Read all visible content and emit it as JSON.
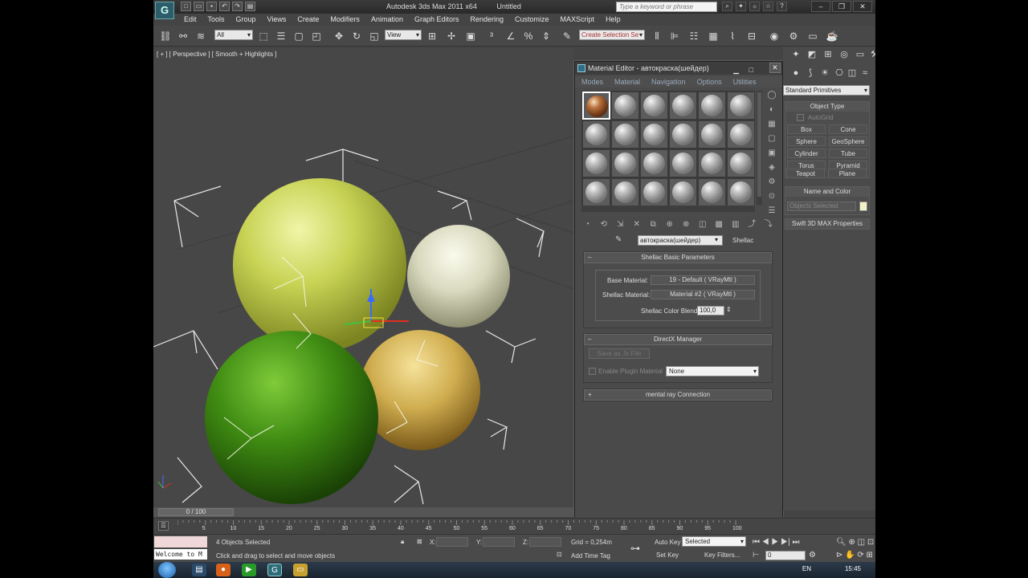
{
  "titlebar": {
    "app_name": "Autodesk 3ds Max 2011 x64",
    "document": "Untitled",
    "search_placeholder": "Type a keyword or phrase",
    "logo": "G"
  },
  "menu": [
    "Edit",
    "Tools",
    "Group",
    "Views",
    "Create",
    "Modifiers",
    "Animation",
    "Graph Editors",
    "Rendering",
    "Customize",
    "MAXScript",
    "Help"
  ],
  "toolbar": {
    "selection_filter": "All",
    "ref_coord": "View",
    "named_selection": "Create Selection Se"
  },
  "viewport": {
    "label": "[ + ] [ Perspective ] [ Smooth + Highlights ]"
  },
  "material_editor": {
    "title": "Material Editor - автокраска(шейдер)",
    "menu": [
      "Modes",
      "Material",
      "Navigation",
      "Options",
      "Utilities"
    ],
    "material_name": "автокраска(шейдер)",
    "material_type": "Shellac",
    "shellac_rollout": {
      "title": "Shellac Basic Parameters",
      "base_label": "Base Material:",
      "base_value": "19 - Default  ( VRayMtl )",
      "shellac_label": "Shellac Material:",
      "shellac_value": "Material #2  ( VRayMtl )",
      "blend_label": "Shellac Color Blend:",
      "blend_value": "100,0"
    },
    "directx_rollout": {
      "title": "DirectX Manager",
      "save_button": "Save as .fx File",
      "plugin_label": "Enable Plugin Material",
      "plugin_value": "None"
    },
    "mentalray_rollout": {
      "title": "mental ray Connection",
      "toggle": "+"
    }
  },
  "command_panel": {
    "category": "Standard Primitives",
    "object_type_title": "Object Type",
    "autogrid": "AutoGrid",
    "buttons": [
      "Box",
      "Cone",
      "Sphere",
      "GeoSphere",
      "Cylinder",
      "Tube",
      "Torus",
      "Pyramid",
      "Teapot",
      "Plane"
    ],
    "name_color_title": "Name and Color",
    "name_field": "Objects Selected",
    "swift": "Swift 3D MAX Properties"
  },
  "timeline": {
    "frame": "0 / 100",
    "ticks": [
      "5",
      "10",
      "15",
      "20",
      "25",
      "30",
      "35",
      "40",
      "45",
      "50",
      "55",
      "60",
      "65",
      "70",
      "75",
      "80",
      "85",
      "90",
      "95",
      "100"
    ]
  },
  "status": {
    "selection": "4 Objects Selected",
    "prompt": "Click and drag to select and move objects",
    "listener": "Welcome to M",
    "x_label": "X:",
    "y_label": "Y:",
    "z_label": "Z:",
    "grid": "Grid = 0,254m",
    "add_time_tag": "Add Time Tag",
    "auto_key": "Auto Key",
    "set_key": "Set Key",
    "key_mode": "Selected",
    "key_filters": "Key Filters...",
    "frame_field": "0"
  },
  "taskbar": {
    "lang": "EN",
    "time": "15:45"
  },
  "colors": {
    "viewport_bg": "#474747",
    "sphere_yellow": "#c9d65a",
    "sphere_white": "#e2e2c8",
    "sphere_gold": "#d7b85c",
    "sphere_green": "#3e8a12"
  }
}
